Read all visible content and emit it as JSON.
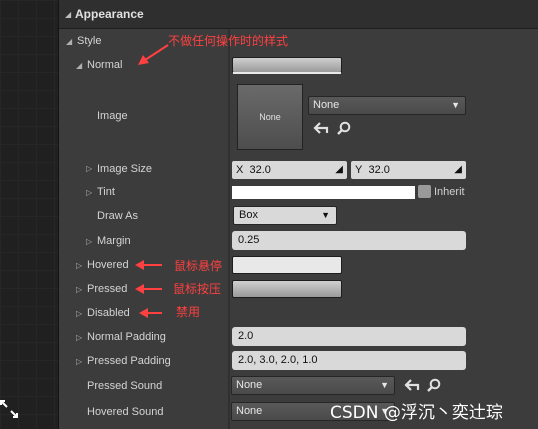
{
  "header": {
    "title": "Appearance"
  },
  "sections": {
    "style": "Style"
  },
  "rows": {
    "normal": "Normal",
    "image": "Image",
    "image_size": "Image Size",
    "tint": "Tint",
    "draw_as": "Draw As",
    "margin": "Margin",
    "hovered": "Hovered",
    "pressed": "Pressed",
    "disabled": "Disabled",
    "normal_padding": "Normal Padding",
    "pressed_padding": "Pressed Padding",
    "pressed_sound": "Pressed Sound",
    "hovered_sound": "Hovered Sound"
  },
  "values": {
    "image_thumb": "None",
    "image_asset": "None",
    "image_size_x_label": "X",
    "image_size_x": "32.0",
    "image_size_y_label": "Y",
    "image_size_y": "32.0",
    "tint_inherit": "Inherit",
    "draw_as": "Box",
    "margin": "0.25",
    "normal_padding": "2.0",
    "pressed_padding": "2.0, 3.0, 2.0, 1.0",
    "pressed_sound": "None",
    "hovered_sound": "None"
  },
  "annotations": {
    "normal": "不做任何操作时的样式",
    "hovered": "鼠标悬停",
    "pressed": "鼠标按压",
    "disabled": "禁用"
  },
  "watermark": "CSDN @浮沉丶奕辻琮",
  "colors": {
    "panel": "#3c3c3c",
    "header": "#2f2f2f",
    "annotation": "#ff4040",
    "field": "#d9d9d9"
  },
  "icons": [
    "back-arrow-icon",
    "search-icon",
    "expand-corner-icon",
    "resize-icon"
  ]
}
